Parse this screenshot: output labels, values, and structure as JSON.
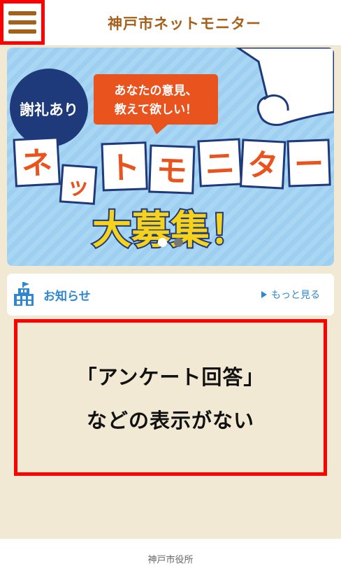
{
  "header": {
    "title": "神戸市ネットモニター",
    "menu_icon": "hamburger-menu-icon"
  },
  "banner": {
    "reward_badge": "謝礼あり",
    "speech_line1": "あなたの意見、",
    "speech_line2": "教えて欲しい！",
    "title_chars": [
      "ネ",
      "ッ",
      "ト",
      "モ",
      "ニ",
      "タ",
      "ー"
    ],
    "bottom_text": "大募集！",
    "slide_count": 2,
    "active_slide": 1
  },
  "news": {
    "icon": "building-icon",
    "title": "お知らせ",
    "more_label": "もっと見る"
  },
  "notice": {
    "line1": "「アンケート回答」",
    "line2": "などの表示がない"
  },
  "footer": {
    "text": "神戸市役所"
  },
  "colors": {
    "brand": "#a5601c",
    "background": "#f1e9d3",
    "link": "#2f87d1",
    "highlight": "#ff0000"
  }
}
